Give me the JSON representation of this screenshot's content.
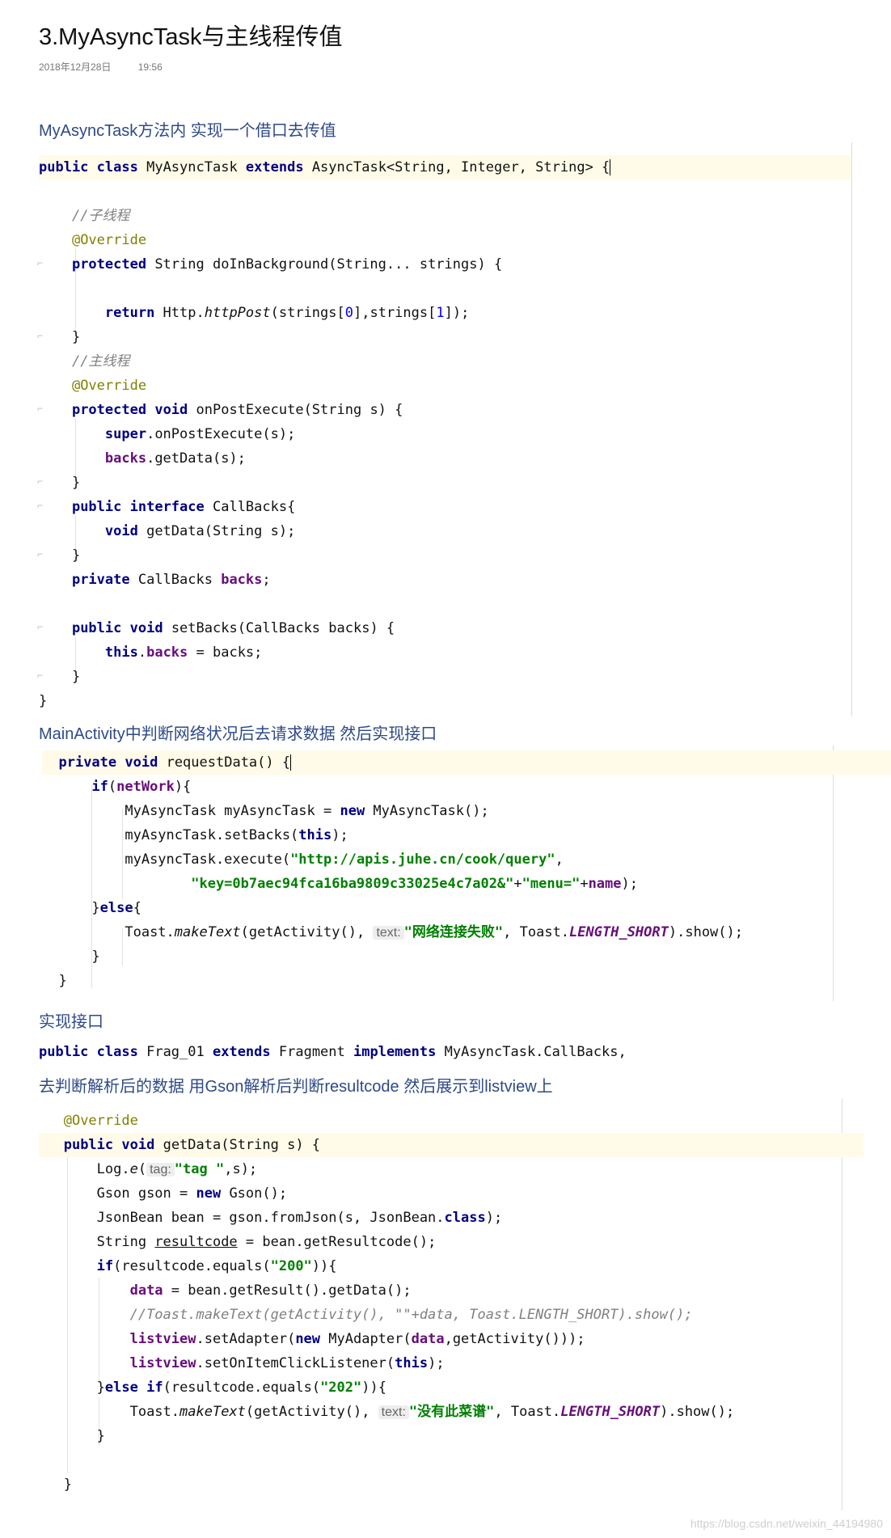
{
  "article": {
    "title": "3.MyAsyncTask与主线程传值",
    "date": "2018年12月28日",
    "time": "19:56",
    "heading1": "MyAsyncTask方法内 实现一个借口去传值",
    "heading2": "MainActivity中判断网络状况后去请求数据 然后实现接口",
    "heading3": "实现接口",
    "heading4": "去判断解析后的数据 用Gson解析后判断resultcode 然后展示到listview上",
    "watermark": "https://blog.csdn.net/weixin_44194980"
  },
  "code1": {
    "public": "public",
    "class": "class",
    "cls": " MyAsyncTask ",
    "extends": "extends",
    "sup": " AsyncTask<String, Integer, String> ",
    "brace": "{",
    "cmt_child": "//子线程",
    "override": "@Override",
    "protected": "protected",
    "dib_sig": " String doInBackground(String... strings) {",
    "return": "return",
    "http": " Http.",
    "httpPost": "httpPost",
    "args_a": "(strings[",
    "zero": "0",
    "args_b": "],strings[",
    "one": "1",
    "args_c": "]);",
    "close": "}",
    "cmt_main": "//主线程",
    "void": "void",
    "ope_sig": " onPostExecute(String s) {",
    "super": "super",
    "super_call": ".onPostExecute(s);",
    "backs": "backs",
    "getdata_call": ".getData(s);",
    "interface": "interface",
    "cb_sig": " CallBacks{",
    "getdata_sig": " getData(String s);",
    "private": "private",
    "cb_type": " CallBacks ",
    "semi": ";",
    "setbacks_sig": " setBacks(CallBacks backs) {",
    "this": "this",
    "dot": ".",
    "assign": " = backs;"
  },
  "code2": {
    "private": "private",
    "void": "void",
    "sig": " requestData() ",
    "brace": "{",
    "if": "if",
    "paren_open": "(",
    "netWork": "netWork",
    "paren_close": "){",
    "task_decl": "MyAsyncTask myAsyncTask = ",
    "new": "new",
    "task_ctor": " MyAsyncTask();",
    "setbacks_a": "myAsyncTask.setBacks(",
    "this": "this",
    "setbacks_b": ");",
    "exec_a": "myAsyncTask.execute(",
    "url": "\"http://apis.juhe.cn/cook/query\"",
    "comma": ",",
    "key": "\"key=0b7aec94fca16ba9809c33025e4c7a02&\"",
    "plus1": "+",
    "menu": "\"menu=\"",
    "plus2": "+",
    "name": "name",
    "exec_end": ");",
    "close_pre": "}",
    "else": "else",
    "else_brace": "{",
    "toast_a": "Toast.",
    "makeText": "makeText",
    "toast_b": "(getActivity(), ",
    "hint": "text:",
    "msg": "\"网络连接失败\"",
    "toast_c": ", Toast.",
    "length_short": "LENGTH_SHORT",
    "toast_d": ").show();",
    "close": "}"
  },
  "code3": {
    "public": "public",
    "class": "class",
    "cls": " Frag_01 ",
    "extends": "extends",
    "frag": " Fragment ",
    "implements": "implements",
    "ifc": " MyAsyncTask.CallBacks,"
  },
  "code4": {
    "override": "@Override",
    "public": "public",
    "void": "void",
    "sig": " getData(String s) {",
    "log_a": "Log.",
    "log_e": "e",
    "log_b": "(",
    "tag_hint": "tag:",
    "tag": "\"tag \"",
    "log_c": ",s);",
    "gson_a": "Gson gson = ",
    "new": "new",
    "gson_b": " Gson();",
    "bean_a": "JsonBean bean = gson.fromJson(s, JsonBean.",
    "class": "class",
    "bean_b": ");",
    "rc_a": "String ",
    "rc_var": "resultcode",
    "rc_b": " = bean.getResultcode();",
    "if": "if",
    "cond_a": "(resultcode.equals(",
    "s200": "\"200\"",
    "cond_b": ")){",
    "data": "data",
    "data_b": " = bean.getResult().getData();",
    "cmt": "//Toast.makeText(getActivity(), \"\"+data, Toast.LENGTH_SHORT).show();",
    "listview": "listview",
    "adapter_a": ".setAdapter(",
    "adapter_b": " MyAdapter(",
    "adapter_c": ",getActivity()));",
    "click_a": ".setOnItemClickListener(",
    "this": "this",
    "click_b": ");",
    "close_pre": "}",
    "else": "else",
    "s202": "\"202\"",
    "toast_a": "Toast.",
    "makeText": "makeText",
    "toast_b": "(getActivity(), ",
    "hint": "text:",
    "msg": "\"没有此菜谱\"",
    "toast_c": ", Toast.",
    "length_short": "LENGTH_SHORT",
    "toast_d": ").show();",
    "close": "}"
  }
}
